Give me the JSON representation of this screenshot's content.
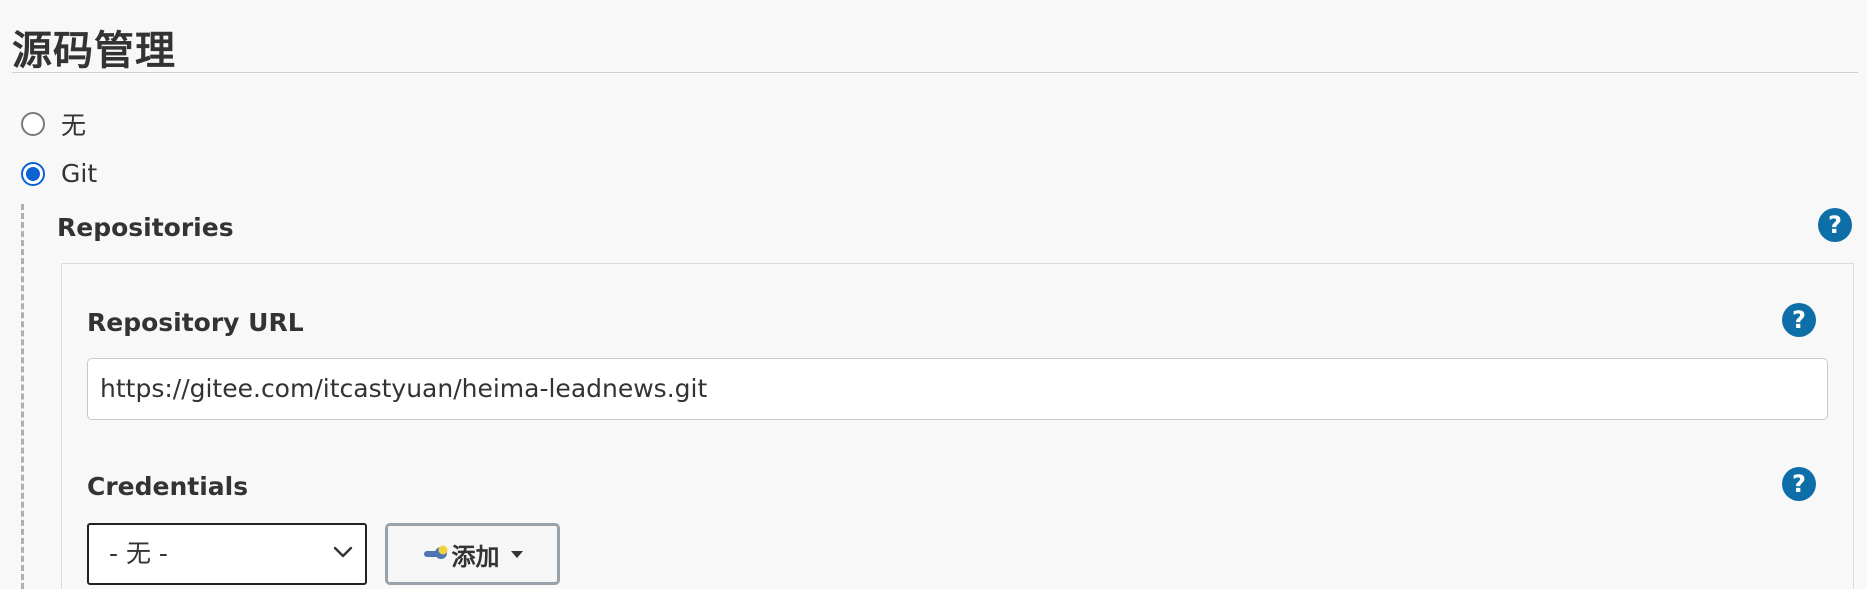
{
  "section": {
    "title": "源码管理"
  },
  "scm_options": {
    "none_label": "无",
    "git_label": "Git",
    "selected": "Git"
  },
  "repositories": {
    "label": "Repositories",
    "help": "?",
    "repository_url": {
      "label": "Repository URL",
      "help": "?",
      "value": "https://gitee.com/itcastyuan/heima-leadnews.git"
    },
    "credentials": {
      "label": "Credentials",
      "help": "?",
      "selected_value": "- 无 -",
      "add_button_label": "添加"
    }
  },
  "colors": {
    "help_icon": "#0e6ea8",
    "radio_checked": "#0b63d1",
    "background": "#f8f8f8"
  }
}
